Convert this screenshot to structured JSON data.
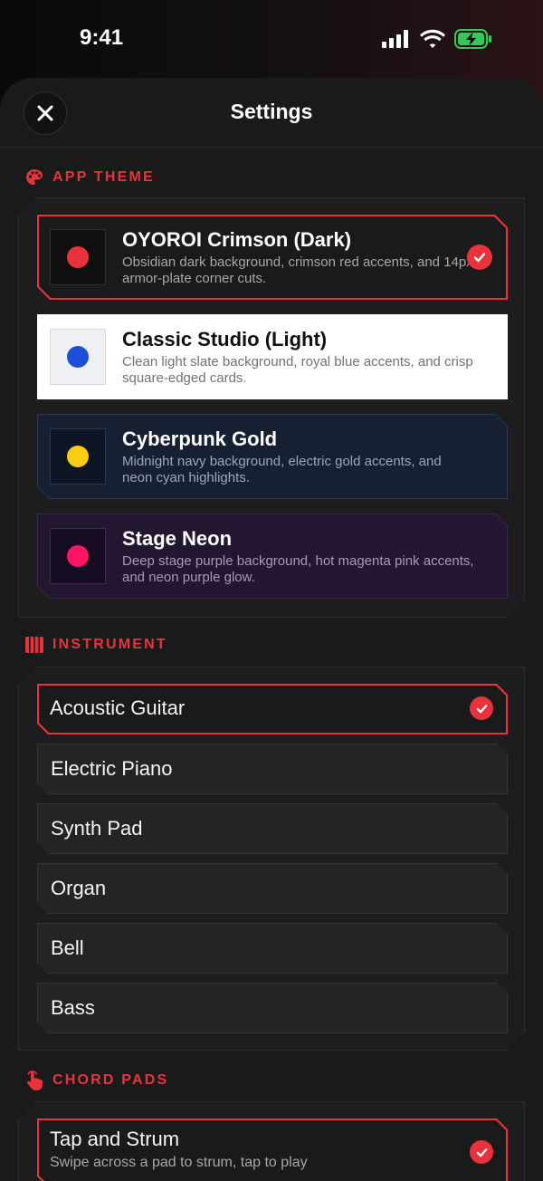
{
  "status_bar": {
    "time": "9:41"
  },
  "header": {
    "title": "Settings"
  },
  "sections": {
    "theme_label": "APP THEME",
    "instrument_label": "INSTRUMENT",
    "chord_pads_label": "CHORD PADS"
  },
  "themes": [
    {
      "name": "OYOROI Crimson (Dark)",
      "desc": "Obsidian dark background, crimson red accents, and 14px armor-plate corner cuts.",
      "accent": "#e8333d",
      "bg": "#1a1a1b",
      "selected": true
    },
    {
      "name": "Classic Studio (Light)",
      "desc": "Clean light slate background, royal blue accents, and crisp square-edged cards.",
      "accent": "#1d4ed8",
      "bg": "#ffffff",
      "selected": false
    },
    {
      "name": "Cyberpunk Gold",
      "desc": "Midnight navy background, electric gold accents, and neon cyan highlights.",
      "accent": "#facc15",
      "bg": "#172033",
      "selected": false
    },
    {
      "name": "Stage Neon",
      "desc": "Deep stage purple background, hot magenta pink accents, and neon purple glow.",
      "accent": "#ff1464",
      "bg": "#231630",
      "selected": false
    }
  ],
  "instruments": [
    {
      "label": "Acoustic Guitar",
      "selected": true
    },
    {
      "label": "Electric Piano",
      "selected": false
    },
    {
      "label": "Synth Pad",
      "selected": false
    },
    {
      "label": "Organ",
      "selected": false
    },
    {
      "label": "Bell",
      "selected": false
    },
    {
      "label": "Bass",
      "selected": false
    }
  ],
  "chord_pads": [
    {
      "label": "Tap and Strum",
      "desc": "Swipe across a pad to strum, tap to play",
      "selected": true
    }
  ],
  "colors": {
    "accent": "#e8333d",
    "sheet_bg": "#1a1a1b",
    "battery": "#34c759"
  }
}
